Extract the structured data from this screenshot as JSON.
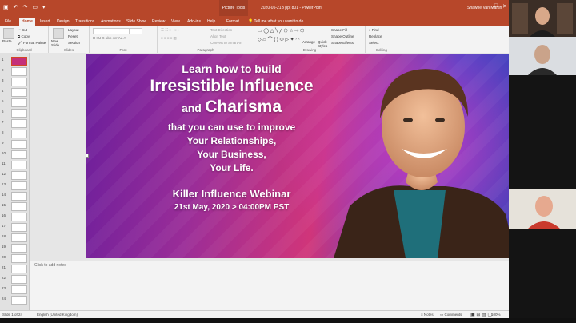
{
  "titlebar": {
    "context_tab": "Picture Tools",
    "doc_title": "2020-05-21B ppt 801 - PowerPoint",
    "user_name": "Shawrie Van Martin",
    "color": "#b7472a"
  },
  "tabs": [
    "File",
    "Home",
    "Insert",
    "Design",
    "Transitions",
    "Animations",
    "Slide Show",
    "Review",
    "View",
    "Add-ins",
    "Help",
    "Format"
  ],
  "tell_me": "Tell me what you want to do",
  "ribbon": {
    "clipboard": {
      "paste": "Paste",
      "cut": "Cut",
      "copy": "Copy",
      "format_painter": "Format Painter",
      "label": "Clipboard"
    },
    "slides": {
      "new_slide": "New Slide",
      "layout": "Layout",
      "reset": "Reset",
      "section": "Section",
      "label": "Slides"
    },
    "font": {
      "label": "Font"
    },
    "paragraph": {
      "text_direction": "Text Direction",
      "align_text": "Align Text",
      "convert_smartart": "Convert to SmartArt",
      "label": "Paragraph"
    },
    "drawing": {
      "arrange": "Arrange",
      "quick_styles": "Quick Styles",
      "shape_fill": "Shape Fill",
      "shape_outline": "Shape Outline",
      "shape_effects": "Shape Effects",
      "label": "Drawing"
    },
    "editing": {
      "find": "Find",
      "replace": "Replace",
      "select": "Select",
      "label": "Editing"
    }
  },
  "thumbnails": [
    "1",
    "2",
    "3",
    "4",
    "5",
    "6",
    "7",
    "8",
    "9",
    "10",
    "11",
    "12",
    "13",
    "14",
    "15",
    "16",
    "17",
    "18",
    "19",
    "20",
    "21",
    "22",
    "23",
    "24"
  ],
  "slide": {
    "line1": "Learn how to build",
    "line2": "Irresistible Influence",
    "line3_and": "and",
    "line3_word": "Charisma",
    "line4": "that you can use to improve",
    "line5": "Your Relationships,",
    "line6": "Your Business,",
    "line7": "Your Life.",
    "webinar": "Killer Influence Webinar",
    "date": "21st May, 2020 > 04:00PM PST"
  },
  "notes_placeholder": "Click to add notes",
  "status": {
    "slide_info": "Slide 1 of 24",
    "language": "English (United Kingdom)",
    "notes": "Notes",
    "comments": "Comments",
    "zoom": "100%"
  }
}
